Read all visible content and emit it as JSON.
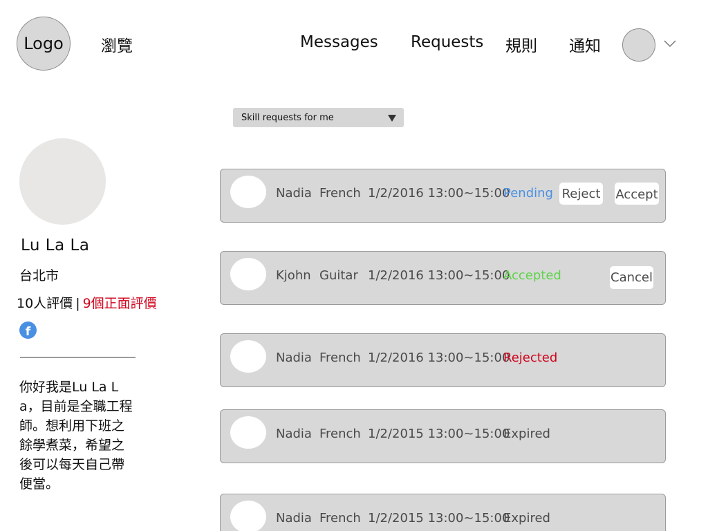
{
  "header": {
    "logo": "Logo",
    "nav": {
      "browse": "瀏覽",
      "messages": "Messages",
      "requests": "Requests",
      "rules": "規則",
      "notifications": "通知"
    }
  },
  "filter": {
    "selected": "Skill requests for me"
  },
  "profile": {
    "name": "Lu La La",
    "city": "台北市",
    "reviews": "10人評價",
    "separator": "|",
    "positive_reviews": "9個正面評價",
    "facebook_glyph": "f",
    "bio": "你好我是Lu La La，目前是全職工程師。想利用下班之餘學煮菜，希望之後可以每天自己帶便當。"
  },
  "requests": [
    {
      "name": "Nadia",
      "skill": "French",
      "time": "1/2/2016 13:00~15:00",
      "status": "Pending",
      "status_color": "#4a90e2",
      "actions": [
        "Reject",
        "Accept"
      ]
    },
    {
      "name": "Kjohn",
      "skill": "Guitar",
      "time": "1/2/2016 13:00~15:00",
      "status": "Accepted",
      "status_color": "#5fd34a",
      "actions": [
        "Cancel"
      ]
    },
    {
      "name": "Nadia",
      "skill": "French",
      "time": "1/2/2016 13:00~15:00",
      "status": "Rejected",
      "status_color": "#d0021b",
      "actions": []
    },
    {
      "name": "Nadia",
      "skill": "French",
      "time": "1/2/2015 13:00~15:00",
      "status": "Expired",
      "status_color": "#4a4a4a",
      "actions": []
    },
    {
      "name": "Nadia",
      "skill": "French",
      "time": "1/2/2015 13:00~15:00",
      "status": "Expired",
      "status_color": "#4a4a4a",
      "actions": []
    }
  ],
  "icons": {
    "chevron": "chevron-down-icon",
    "facebook": "facebook-icon",
    "select_arrow": "triangle-down-icon"
  }
}
